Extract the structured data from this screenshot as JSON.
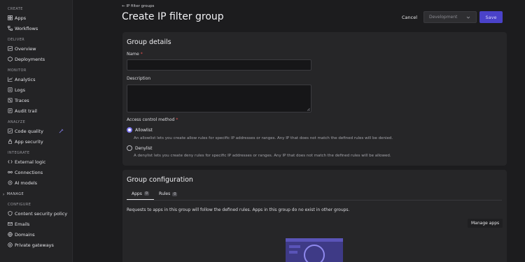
{
  "sidebar": {
    "sections": [
      {
        "title": "CREATE",
        "items": [
          {
            "label": "Apps",
            "icon": "apps-icon"
          },
          {
            "label": "Workflows",
            "icon": "workflows-icon"
          }
        ]
      },
      {
        "title": "DELIVER",
        "items": [
          {
            "label": "Overview",
            "icon": "overview-icon"
          },
          {
            "label": "Deployments",
            "icon": "deployments-icon"
          }
        ]
      },
      {
        "title": "MONITOR",
        "items": [
          {
            "label": "Analytics",
            "icon": "analytics-icon"
          },
          {
            "label": "Logs",
            "icon": "logs-icon"
          },
          {
            "label": "Traces",
            "icon": "traces-icon"
          },
          {
            "label": "Audit trail",
            "icon": "audit-trail-icon"
          }
        ]
      },
      {
        "title": "ANALYZE",
        "items": [
          {
            "label": "Code quality",
            "icon": "code-quality-icon"
          },
          {
            "label": "App security",
            "icon": "app-security-icon"
          }
        ]
      },
      {
        "title": "INTEGRATE",
        "items": [
          {
            "label": "External logic",
            "icon": "external-logic-icon"
          },
          {
            "label": "Connections",
            "icon": "connections-icon"
          },
          {
            "label": "AI models",
            "icon": "ai-models-icon"
          }
        ]
      }
    ],
    "manage_label": "MANAGE",
    "configure": {
      "title": "CONFIGURE",
      "items": [
        {
          "label": "Content security policy"
        },
        {
          "label": "Emails"
        },
        {
          "label": "Domains"
        },
        {
          "label": "Private gateways"
        }
      ]
    }
  },
  "header": {
    "back_label": "IP filter groups",
    "title": "Create IP filter group",
    "cancel_label": "Cancel",
    "environment_selected": "Development",
    "save_label": "Save"
  },
  "group_details": {
    "heading": "Group details",
    "name_label": "Name",
    "name_value": "",
    "description_label": "Description",
    "description_value": "",
    "access_label": "Access control method",
    "required_mark": "*",
    "allowlist_label": "Allowlist",
    "allowlist_help": "An allowlist lets you create allow rules for specific IP addresses or ranges. Any IP that does not match the defined rules will be denied.",
    "denylist_label": "Denylist",
    "denylist_help": "A denylist lets you create deny rules for specific IP addresses or ranges. Any IP that does not match the defined rules will be allowed.",
    "selected_method": "Allowlist"
  },
  "group_configuration": {
    "heading": "Group configuration",
    "tabs": [
      {
        "label": "Apps",
        "count": "0"
      },
      {
        "label": "Rules",
        "count": "0"
      }
    ],
    "active_tab": "Apps",
    "description": "Requests to apps in this group will follow the defined rules. Apps in this group do no exist in other groups.",
    "manage_apps_label": "Manage apps"
  },
  "colors": {
    "accent": "#4a42c9",
    "radio_selected": "#7d76f0",
    "required": "#e0504f",
    "background": "#1c1c1e",
    "card": "#262628"
  }
}
